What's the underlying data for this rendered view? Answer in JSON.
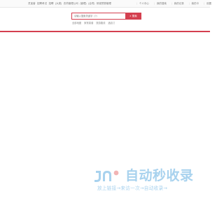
{
  "topbar": {
    "left_items": [
      "灵宝营",
      "招聘考试",
      "招聘",
      "(大类)",
      "农药管理公司",
      "(管理)",
      "(合同)",
      "桥梁预算管理"
    ],
    "right_items": [
      "个人中心",
      "我的搜索",
      "我的记录",
      "我的卡",
      "设置"
    ]
  },
  "search": {
    "placeholder": "请输入搜索关键字（?）",
    "button_label": "搜索",
    "button_icon": "search-icon"
  },
  "hot_words": [
    "全部地图",
    "家常菜谱",
    "旅游路线",
    "酒店订"
  ],
  "logo": {
    "text": "自动秒收录",
    "slogan": "放上链接→来访一次→自动收录→",
    "colors": {
      "mark_primary": "#a8d2ee",
      "mark_accent": "#f2b4b4"
    }
  },
  "colors": {
    "accent": "#d43f4f",
    "logo": "#a8d2ee"
  }
}
